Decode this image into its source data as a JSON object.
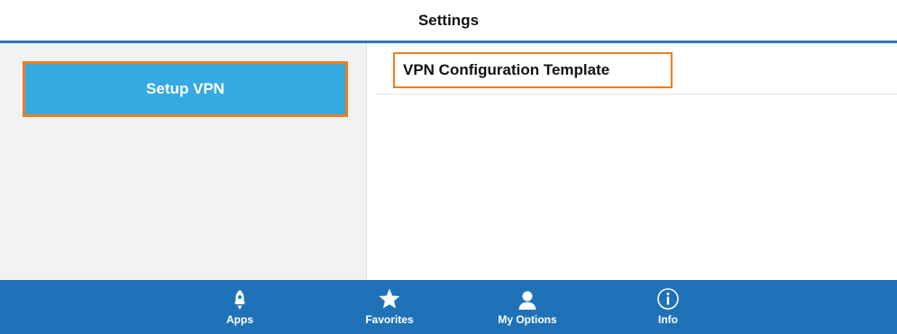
{
  "header": {
    "title": "Settings"
  },
  "sidebar": {
    "items": [
      {
        "label": "Setup VPN",
        "selected": true
      }
    ]
  },
  "content": {
    "items": [
      {
        "label": "VPN Configuration Template"
      }
    ]
  },
  "tabbar": {
    "tabs": [
      {
        "label": "Apps",
        "icon": "rocket-icon"
      },
      {
        "label": "Favorites",
        "icon": "star-icon"
      },
      {
        "label": "My Options",
        "icon": "person-icon"
      },
      {
        "label": "Info",
        "icon": "info-icon"
      }
    ]
  },
  "colors": {
    "accent": "#35a9e1",
    "highlight_border": "#ef7c21",
    "tabbar_background": "#1f72b8",
    "sidebar_background": "#f2f2f2"
  }
}
